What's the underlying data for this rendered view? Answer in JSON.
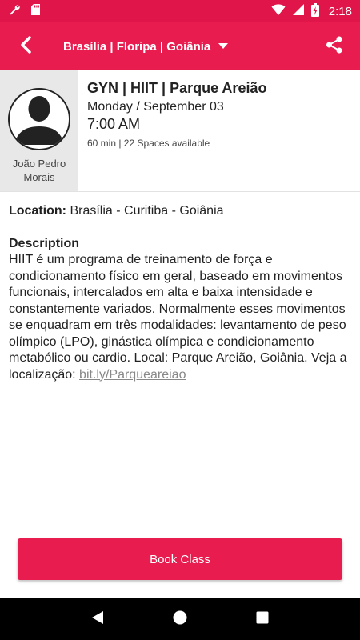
{
  "status_bar": {
    "time": "2:18",
    "icons": [
      "wrench-icon",
      "sd-card-icon",
      "wifi-icon",
      "signal-icon",
      "battery-charging-icon"
    ]
  },
  "app_bar": {
    "title": "Brasília | Floripa | Goiânia",
    "back_icon": "back-arrow-icon",
    "dropdown_icon": "dropdown-caret-icon",
    "share_icon": "share-icon"
  },
  "instructor": {
    "name": "João Pedro Morais",
    "avatar_icon": "person-silhouette-icon"
  },
  "class": {
    "title": "GYN | HIIT | Parque Areião",
    "date": "Monday / September 03",
    "time": "7:00 AM",
    "meta": "60 min | 22 Spaces available"
  },
  "details": {
    "location_label": "Location:",
    "location_value": " Brasília - Curitiba - Goiânia",
    "description_label": "Description",
    "description_text": "HIIT é um programa de treinamento de força e condicionamento físico em geral, baseado em movimentos funcionais, intercalados em alta e baixa intensidade e constantemente variados. Normalmente esses movimentos se enquadram em três modalidades: levantamento de peso olímpico (LPO), ginástica olímpica e condicionamento metabólico ou cardio. Local: Parque Areião, Goiânia. Veja a localização: ",
    "description_link": "bit.ly/Parqueareiao"
  },
  "actions": {
    "book_label": "Book Class"
  },
  "nav_bar": {
    "icons": [
      "nav-back-icon",
      "nav-home-icon",
      "nav-recents-icon"
    ]
  },
  "colors": {
    "primary": "#e81c4f",
    "status_bar": "#e0154a",
    "instructor_bg": "#e8e8e8",
    "link": "#888888"
  }
}
